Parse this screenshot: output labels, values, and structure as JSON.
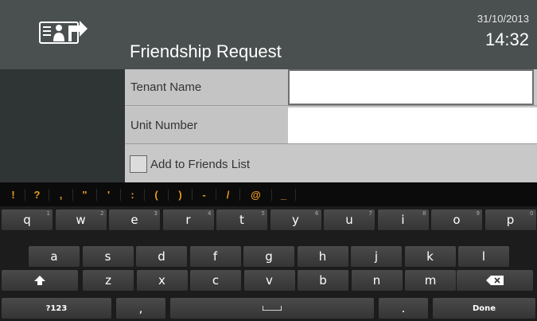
{
  "header": {
    "title": "Friendship Request",
    "date": "31/10/2013",
    "time": "14:32",
    "icon": "tenant-arrow-icon"
  },
  "form": {
    "tenant_name_label": "Tenant Name",
    "tenant_name_value": "",
    "unit_number_label": "Unit Number",
    "unit_number_value": "",
    "add_friends_label": "Add to Friends List",
    "add_friends_checked": false
  },
  "keyboard": {
    "symbols": [
      "!",
      "?",
      ",",
      "\"",
      "'",
      ":",
      "(",
      ")",
      "-",
      "/",
      "@",
      "_"
    ],
    "row1": [
      {
        "label": "q",
        "hint": "1"
      },
      {
        "label": "w",
        "hint": "2"
      },
      {
        "label": "e",
        "hint": "3"
      },
      {
        "label": "r",
        "hint": "4"
      },
      {
        "label": "t",
        "hint": "5"
      },
      {
        "label": "y",
        "hint": "6"
      },
      {
        "label": "u",
        "hint": "7"
      },
      {
        "label": "i",
        "hint": "8"
      },
      {
        "label": "o",
        "hint": "9"
      },
      {
        "label": "p",
        "hint": "0"
      }
    ],
    "row2": [
      "a",
      "s",
      "d",
      "f",
      "g",
      "h",
      "j",
      "k",
      "l"
    ],
    "row3": [
      "z",
      "x",
      "c",
      "v",
      "b",
      "n",
      "m"
    ],
    "mode_key": "?123",
    "comma_key": ",",
    "period_key": ".",
    "done_key": "Done"
  }
}
